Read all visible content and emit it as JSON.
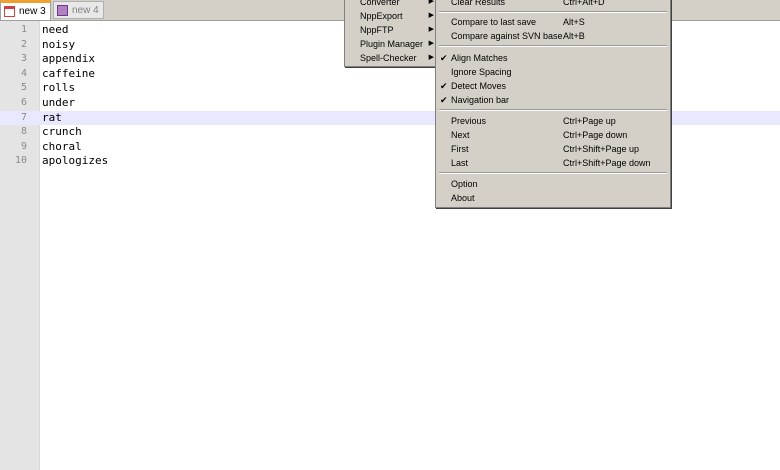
{
  "tabs": [
    {
      "label": "new 3",
      "active": true
    },
    {
      "label": "new 4",
      "active": false
    }
  ],
  "editor": {
    "current_line": 7,
    "lines": [
      {
        "n": "1",
        "text": "need"
      },
      {
        "n": "2",
        "text": "noisy"
      },
      {
        "n": "3",
        "text": "appendix"
      },
      {
        "n": "4",
        "text": "caffeine"
      },
      {
        "n": "5",
        "text": "rolls"
      },
      {
        "n": "6",
        "text": "under"
      },
      {
        "n": "7",
        "text": "rat"
      },
      {
        "n": "8",
        "text": "crunch"
      },
      {
        "n": "9",
        "text": "choral"
      },
      {
        "n": "10",
        "text": "apologizes"
      }
    ]
  },
  "plugins_menu": {
    "items": [
      "Converter",
      "NppExport",
      "NppFTP",
      "Plugin Manager",
      "Spell-Checker"
    ]
  },
  "compare_menu": {
    "clear_results": {
      "label": "Clear Results",
      "shortcut": "Ctrl+Alt+D"
    },
    "compare_last_save": {
      "label": "Compare to last save",
      "shortcut": "Alt+S"
    },
    "compare_svn": {
      "label": "Compare against SVN base",
      "shortcut": "Alt+B"
    },
    "align_matches": {
      "label": "Align Matches",
      "checked": true
    },
    "ignore_spacing": {
      "label": "Ignore Spacing",
      "checked": false
    },
    "detect_moves": {
      "label": "Detect Moves",
      "checked": true
    },
    "navigation_bar": {
      "label": "Navigation bar",
      "checked": true
    },
    "previous": {
      "label": "Previous",
      "shortcut": "Ctrl+Page up"
    },
    "next": {
      "label": "Next",
      "shortcut": "Ctrl+Page down"
    },
    "first": {
      "label": "First",
      "shortcut": "Ctrl+Shift+Page up"
    },
    "last": {
      "label": "Last",
      "shortcut": "Ctrl+Shift+Page down"
    },
    "option": {
      "label": "Option"
    },
    "about": {
      "label": "About"
    },
    "check_glyph": "✔",
    "submenu_arrow": "▶"
  }
}
